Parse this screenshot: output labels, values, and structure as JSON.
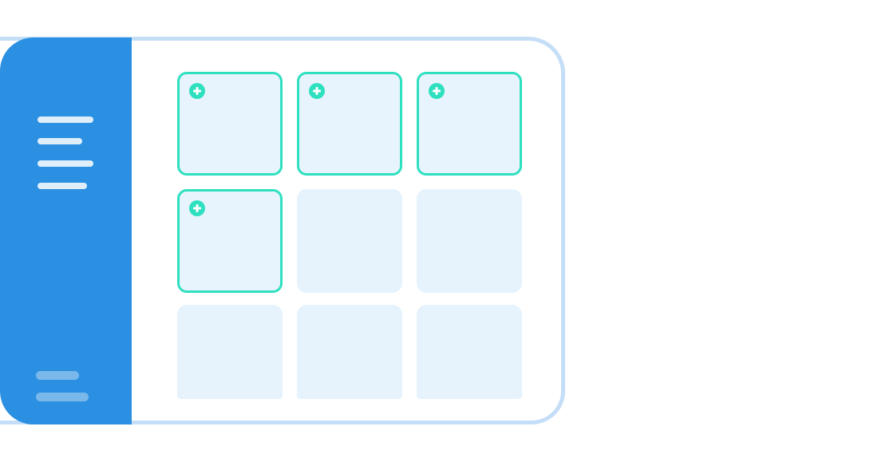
{
  "sidebar": {
    "menu_items": [
      "menu-item-1",
      "menu-item-2",
      "menu-item-3",
      "menu-item-4"
    ],
    "footer_items": [
      "footer-item-1",
      "footer-item-2"
    ]
  },
  "grid": {
    "rows": 3,
    "columns": 3,
    "tiles": [
      {
        "state": "added",
        "icon": "plus-circle-icon"
      },
      {
        "state": "added",
        "icon": "plus-circle-icon"
      },
      {
        "state": "added",
        "icon": "plus-circle-icon"
      },
      {
        "state": "added",
        "icon": "plus-circle-icon"
      },
      {
        "state": "empty"
      },
      {
        "state": "empty"
      },
      {
        "state": "empty"
      },
      {
        "state": "empty"
      },
      {
        "state": "empty"
      }
    ]
  },
  "colors": {
    "sidebar": "#2b90e1",
    "frame_border": "#c5def7",
    "tile_fill": "#e6f3fd",
    "accent": "#2ee0c0"
  }
}
